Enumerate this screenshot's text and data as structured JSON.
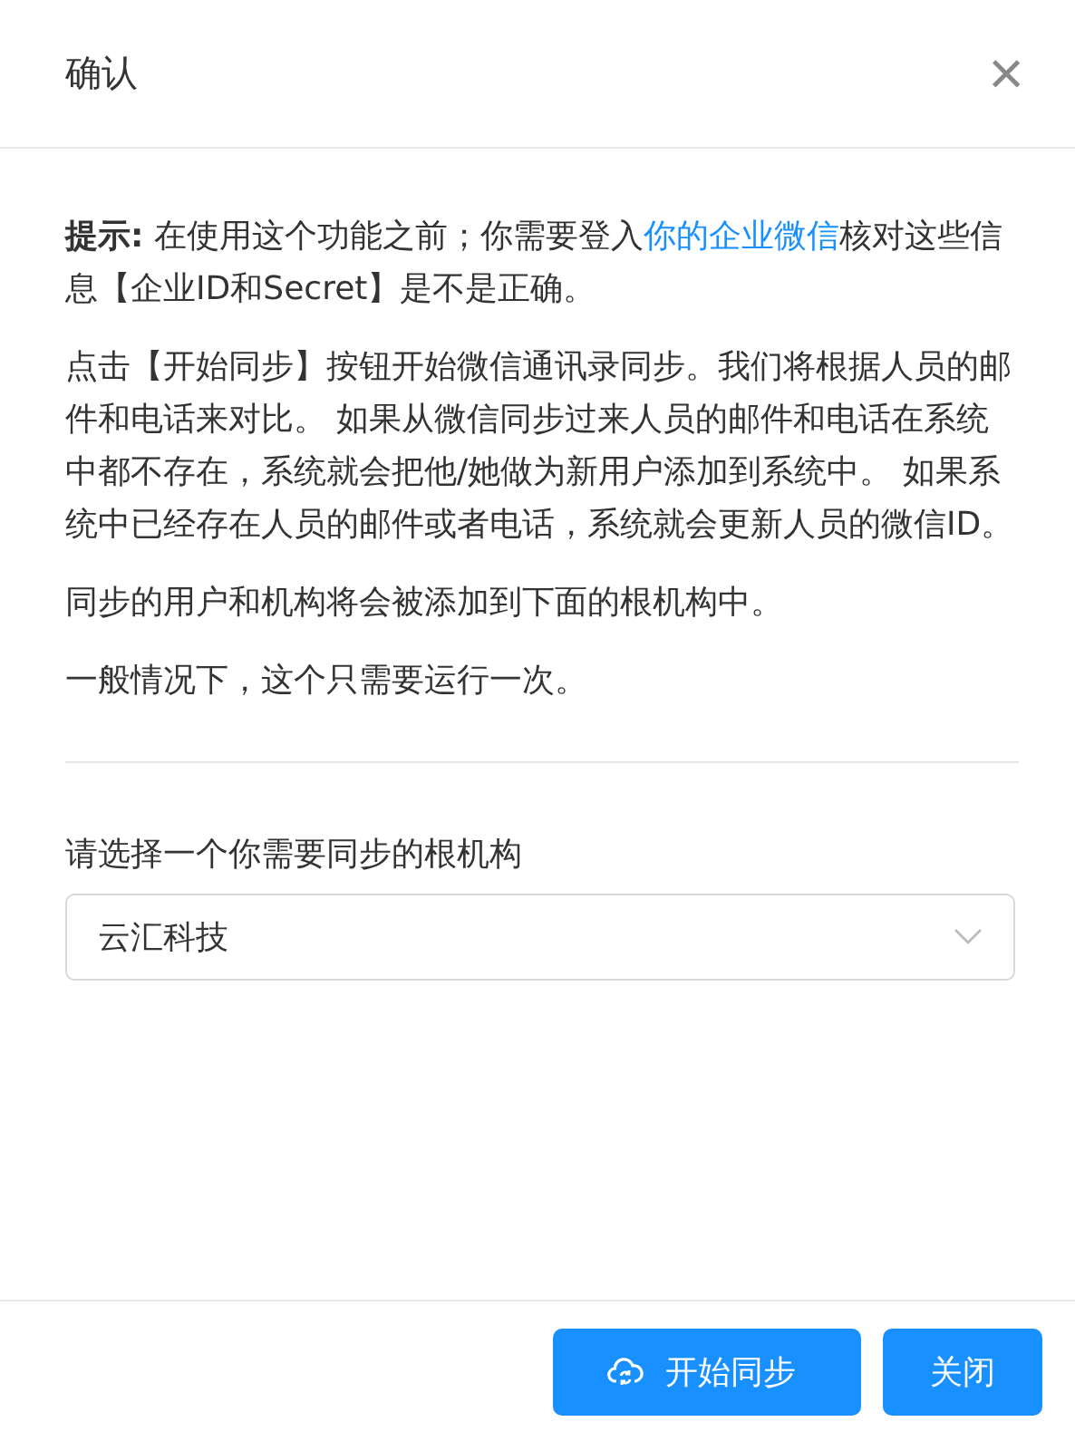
{
  "dialog": {
    "title": "确认",
    "close": "×"
  },
  "hint": {
    "before": "**提示:** 在使用这个功能之前；你需要登入",
    "link": "你的企业微信",
    "after": "核对这些信息【企业ID和Secret】是不是正确。"
  },
  "paragraphs": [
    "点击【开始同步】按钮开始微信通讯录同步。我们将根据人员的邮件和电话来对比。 如果从微信同步过来人员的邮件和电话在系统中都不存在，系统就会把他/她做为新用户添加到系统中。 如果系统中已经存在人员的邮件或者电话，系统就会更新人员的微信ID。",
    "同步的用户和机构将会被添加到下面的根机构中。",
    "一般情况下，这个只需要运行一次。"
  ],
  "select": {
    "label": "请选择一个你需要同步的根机构",
    "value": "云汇科技"
  },
  "buttons": [
    {
      "kind": "sync",
      "label": "开始同步"
    },
    {
      "kind": "plain",
      "label": "关闭"
    }
  ]
}
